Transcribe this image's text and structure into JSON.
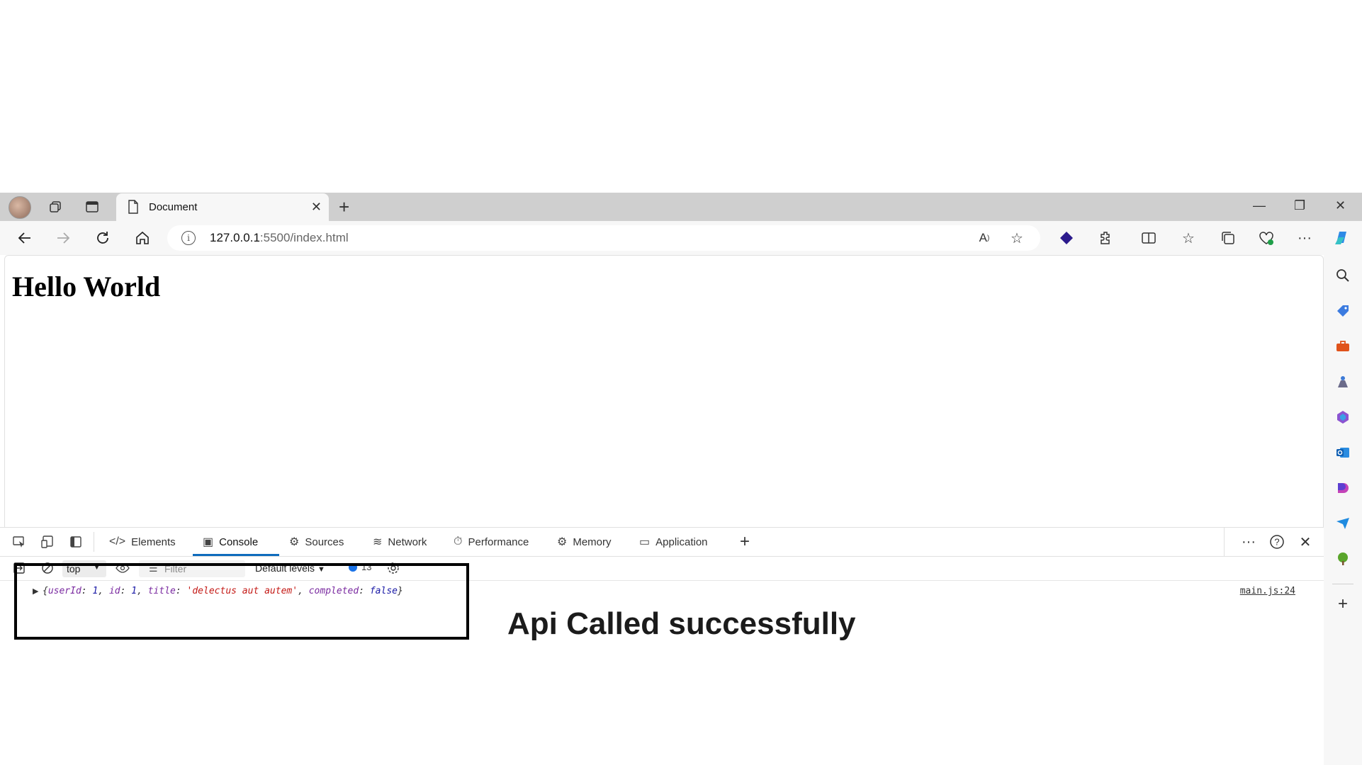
{
  "browser": {
    "tab": {
      "title": "Document",
      "close": "✕"
    },
    "new_tab": "+",
    "window_controls": {
      "minimize": "—",
      "maximize": "❐",
      "close": "✕"
    },
    "address": {
      "host": "127.0.0.1",
      "path": ":5500/index.html"
    },
    "toolbar_icons": [
      "back-icon",
      "forward-icon",
      "refresh-icon",
      "home-icon",
      "read-aloud-icon",
      "favorite-star-icon",
      "extension-shield-icon",
      "extensions-icon",
      "split-screen-icon",
      "favorites-icon",
      "collections-icon",
      "browser-essentials-icon",
      "more-icon",
      "copilot-icon"
    ],
    "sidebar_icons": [
      "search-icon",
      "shopping-tag-icon",
      "tools-icon",
      "games-icon",
      "office-icon",
      "outlook-icon",
      "designer-icon",
      "send-icon",
      "tree-icon",
      "add-icon"
    ]
  },
  "page": {
    "heading": "Hello World"
  },
  "devtools": {
    "tabs": [
      {
        "label": "Elements",
        "icon": "</>"
      },
      {
        "label": "Console",
        "icon": "▣"
      },
      {
        "label": "Sources",
        "icon": "⚙"
      },
      {
        "label": "Network",
        "icon": "≋"
      },
      {
        "label": "Performance",
        "icon": "⏱"
      },
      {
        "label": "Memory",
        "icon": "⚙"
      },
      {
        "label": "Application",
        "icon": "▭"
      }
    ],
    "active_tab": "Console",
    "add_tab": "+",
    "console": {
      "context": "top",
      "filter_placeholder": "Filter",
      "levels": "Default levels",
      "message_count": "13",
      "log": {
        "open": "{",
        "k1": "userId",
        "v1": "1",
        "k2": "id",
        "v2": "1",
        "k3": "title",
        "v3": "'delectus aut autem'",
        "k4": "completed",
        "v4": "false",
        "close": "}",
        "source": "main.js:24"
      },
      "prompt": "›"
    }
  },
  "annotation": {
    "text": "Api Called successfully"
  }
}
